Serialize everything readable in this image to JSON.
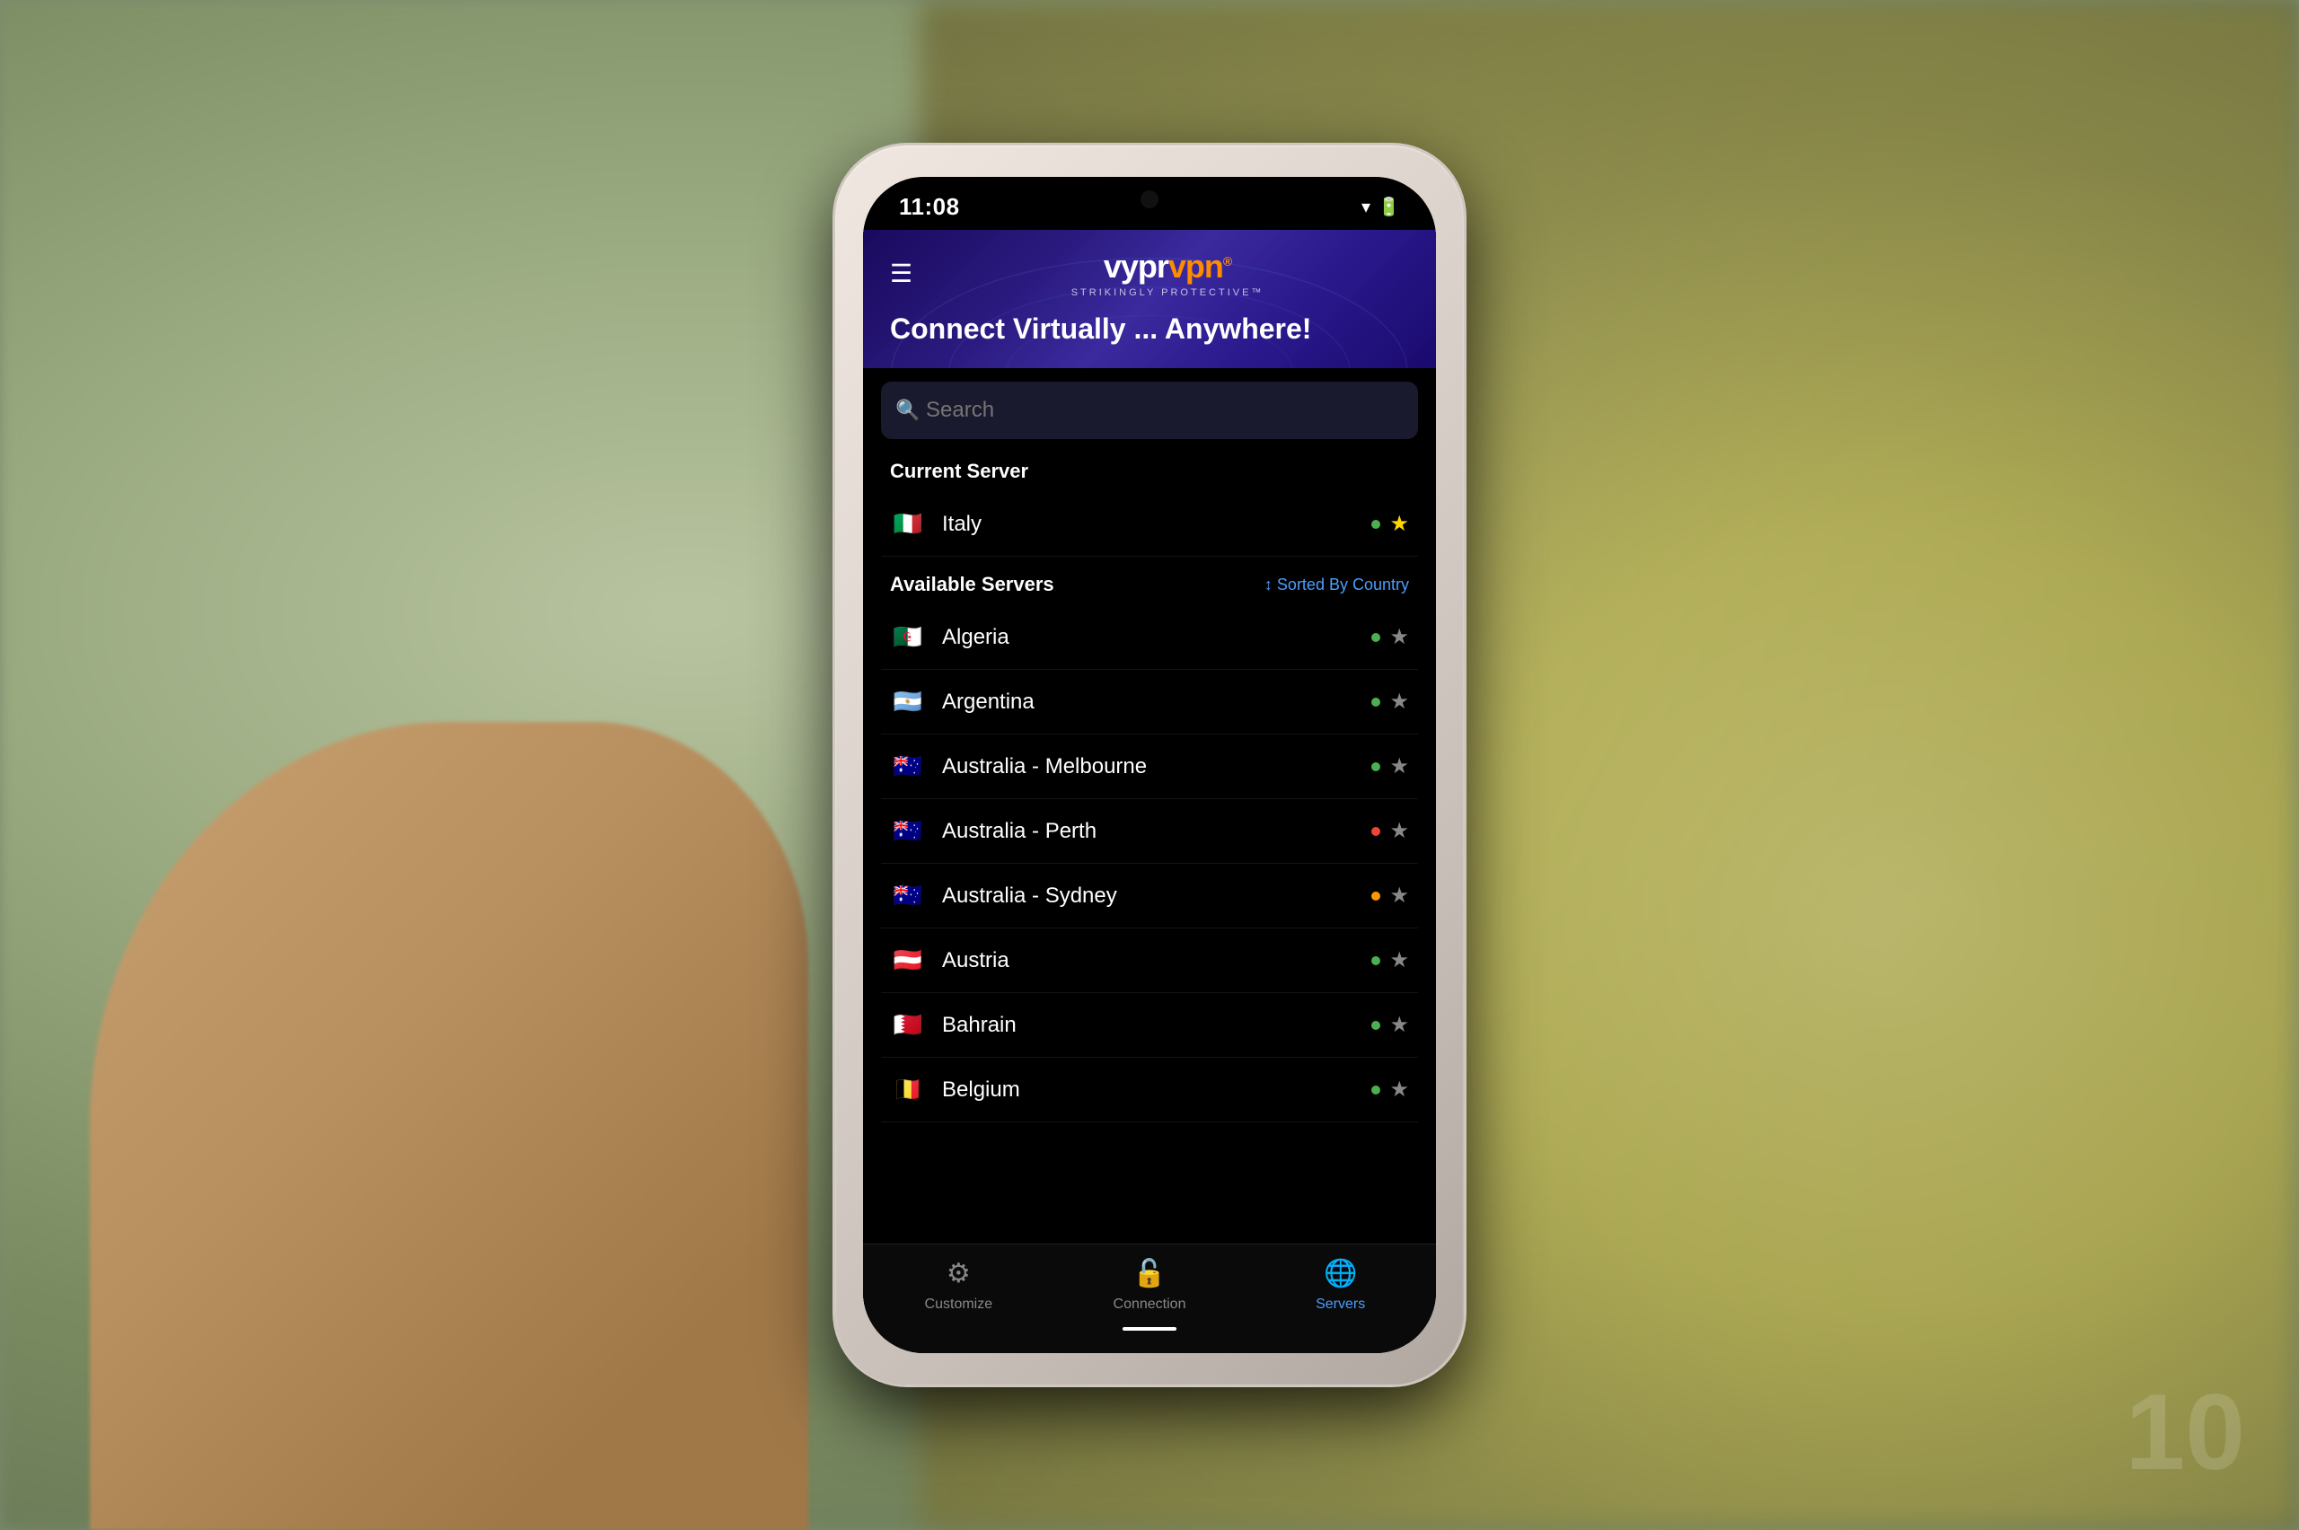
{
  "background": {
    "color": "#7a8a70"
  },
  "statusBar": {
    "time": "11:08",
    "wifiIcon": "▼",
    "batteryIcon": "🔋"
  },
  "header": {
    "menuIcon": "☰",
    "logoText": "vyprvpn",
    "logoRegistered": "®",
    "tagline": "STRIKINGLY PROTECTIVE™",
    "title": "Connect Virtually ... Anywhere!"
  },
  "search": {
    "placeholder": "Search"
  },
  "currentServer": {
    "sectionTitle": "Current Server",
    "server": {
      "name": "Italy",
      "flag": "🇮🇹",
      "statusDot": "green",
      "starred": true
    }
  },
  "availableServers": {
    "sectionTitle": "Available Servers",
    "sortLabel": "Sorted By Country",
    "sortIcon": "↕",
    "servers": [
      {
        "name": "Algeria",
        "flag": "🇩🇿",
        "statusDot": "green",
        "starred": false
      },
      {
        "name": "Argentina",
        "flag": "🇦🇷",
        "statusDot": "green",
        "starred": false
      },
      {
        "name": "Australia - Melbourne",
        "flag": "🇦🇺",
        "statusDot": "green",
        "starred": false
      },
      {
        "name": "Australia - Perth",
        "flag": "🇦🇺",
        "statusDot": "red",
        "starred": false
      },
      {
        "name": "Australia - Sydney",
        "flag": "🇦🇺",
        "statusDot": "orange",
        "starred": false
      },
      {
        "name": "Austria",
        "flag": "🇦🇹",
        "statusDot": "green",
        "starred": false
      },
      {
        "name": "Bahrain",
        "flag": "🇧🇭",
        "statusDot": "green",
        "starred": false
      },
      {
        "name": "Belgium",
        "flag": "🇧🇪",
        "statusDot": "green",
        "starred": false
      }
    ]
  },
  "bottomNav": {
    "items": [
      {
        "label": "Customize",
        "icon": "⚙",
        "active": false
      },
      {
        "label": "Connection",
        "icon": "🔓",
        "active": false
      },
      {
        "label": "Servers",
        "icon": "🌐",
        "active": true
      }
    ]
  },
  "watermark": "10"
}
